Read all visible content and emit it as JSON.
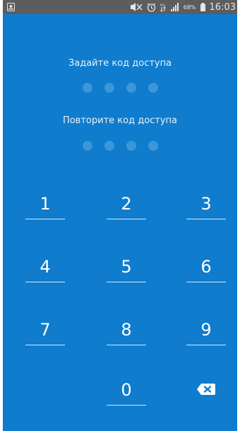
{
  "statusbar": {
    "battery_percent": "68%",
    "time": "16:03",
    "icons": [
      "image-icon",
      "mute-vibrate-icon",
      "alarm-icon",
      "mobile-data-icon",
      "signal-icon",
      "battery-icon"
    ]
  },
  "passcode": {
    "set_title": "Задайте код доступа",
    "repeat_title": "Повторите код доступа",
    "dots_per_field": 4
  },
  "keypad": {
    "keys": [
      "1",
      "2",
      "3",
      "4",
      "5",
      "6",
      "7",
      "8",
      "9",
      "0"
    ],
    "backspace_icon": "backspace-icon"
  },
  "colors": {
    "background": "#0f7ccd",
    "dot": "#3c96d8",
    "statusbar": "#5d5d5d"
  }
}
